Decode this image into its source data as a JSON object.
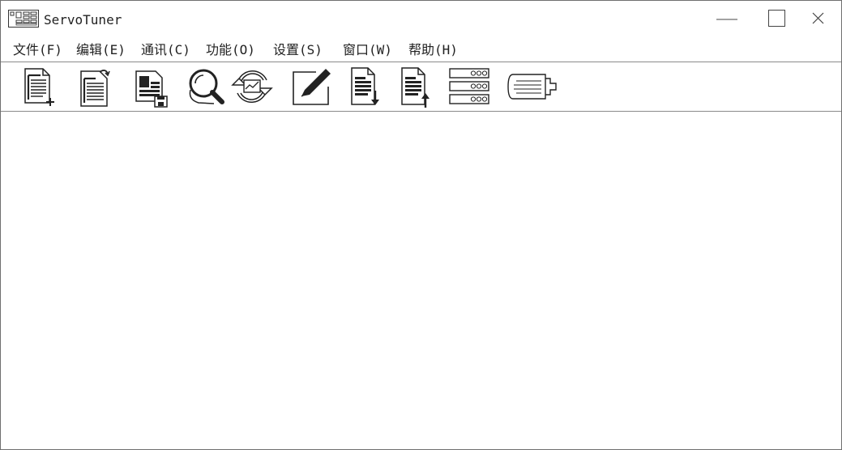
{
  "window": {
    "title": "ServoTuner",
    "controls": {
      "minimize_icon": "minimize-icon",
      "maximize_icon": "maximize-icon",
      "close_icon": "close-icon"
    }
  },
  "menubar": {
    "items": [
      {
        "label": "文件(F)"
      },
      {
        "label": "编辑(E)"
      },
      {
        "label": "通讯(C)"
      },
      {
        "label": "功能(O)"
      },
      {
        "label": "设置(S)"
      },
      {
        "label": "窗口(W)"
      },
      {
        "label": "帮助(H)"
      }
    ]
  },
  "toolbar": {
    "tools": [
      {
        "icon": "new-document-icon"
      },
      {
        "icon": "open-document-icon"
      },
      {
        "icon": "save-document-icon"
      },
      {
        "icon": "search-icon"
      },
      {
        "icon": "sync-icon"
      },
      {
        "icon": "edit-icon"
      },
      {
        "icon": "download-icon"
      },
      {
        "icon": "upload-icon"
      },
      {
        "icon": "server-list-icon"
      },
      {
        "icon": "servo-motor-icon"
      }
    ]
  },
  "colors": {
    "foreground": "#222222",
    "border": "#8a8a8a",
    "background": "#ffffff"
  }
}
